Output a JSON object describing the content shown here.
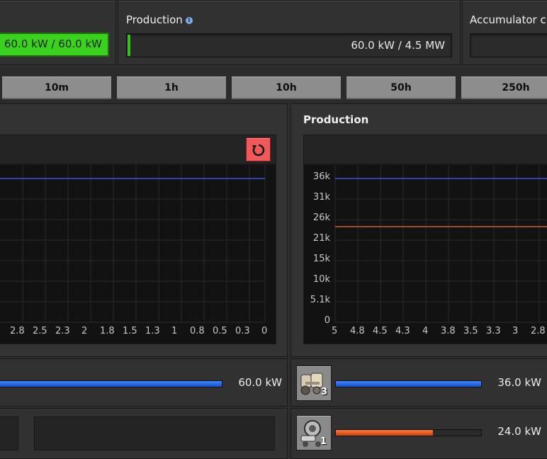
{
  "top": {
    "left_value": "60.0 kW / 60.0 kW",
    "production_label": "Production",
    "production_value": "60.0 kW / 4.5 MW",
    "accumulator_label": "Accumulator ch"
  },
  "tabs": [
    "10m",
    "1h",
    "10h",
    "50h",
    "250h"
  ],
  "left_graph": {
    "x_ticks": [
      "2.8",
      "2.5",
      "2.3",
      "2",
      "1.8",
      "1.5",
      "1.3",
      "1",
      "0.8",
      "0.5",
      "0.3",
      "0"
    ]
  },
  "right_graph": {
    "title": "Production",
    "y_ticks": [
      "36k",
      "31k",
      "26k",
      "21k",
      "15k",
      "10k",
      "5.1k",
      "0"
    ],
    "x_ticks": [
      "5",
      "4.8",
      "4.5",
      "4.3",
      "4",
      "3.8",
      "3.5",
      "3.3",
      "3",
      "2.8"
    ]
  },
  "chart_data": [
    {
      "type": "line",
      "title": "",
      "series": [
        {
          "color": "#4a5cff",
          "values": [
            36000,
            36000
          ]
        }
      ],
      "x_ticks": [
        "2.8",
        "2.5",
        "2.3",
        "2",
        "1.8",
        "1.5",
        "1.3",
        "1",
        "0.8",
        "0.5",
        "0.3",
        "0"
      ]
    },
    {
      "type": "line",
      "title": "Production",
      "ylim": [
        0,
        36000
      ],
      "series": [
        {
          "color": "#4a5cff",
          "values": [
            36000,
            36000
          ]
        },
        {
          "color": "#ff6a3a",
          "values": [
            24000,
            24000
          ]
        }
      ],
      "x_ticks": [
        "5",
        "4.8",
        "4.5",
        "4.3",
        "4",
        "3.8",
        "3.5",
        "3.3",
        "3",
        "2.8"
      ]
    }
  ],
  "rows": {
    "left_value": "60.0 kW",
    "right": [
      {
        "count": "3",
        "value": "36.0 kW",
        "fill_fraction": 1.0,
        "color": "#2a63e8",
        "icon": "steam-engine-icon"
      },
      {
        "count": "1",
        "value": "24.0 kW",
        "fill_fraction": 0.67,
        "color": "#e8561a",
        "icon": "solar-panel-icon"
      }
    ]
  }
}
